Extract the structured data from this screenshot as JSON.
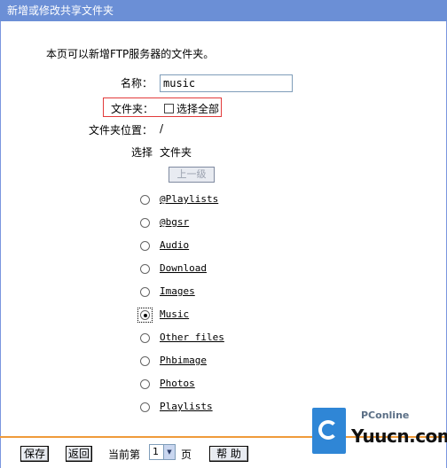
{
  "title": "新增或修改共享文件夹",
  "intro": "本页可以新增FTP服务器的文件夹。",
  "name_label": "名称：",
  "name_value": "music",
  "folder_label": "文件夹：",
  "select_all_label": "选择全部",
  "location_label": "文件夹位置：",
  "location_value": "/",
  "col_select": "选择",
  "col_folder": "文件夹",
  "up_button": "上一级",
  "folders": [
    {
      "label": "@Playlists",
      "selected": false
    },
    {
      "label": "@bgsr",
      "selected": false
    },
    {
      "label": "Audio",
      "selected": false
    },
    {
      "label": "Download",
      "selected": false
    },
    {
      "label": "Images",
      "selected": false
    },
    {
      "label": "Music",
      "selected": true
    },
    {
      "label": "Other files",
      "selected": false
    },
    {
      "label": "Phbimage",
      "selected": false
    },
    {
      "label": "Photos",
      "selected": false
    },
    {
      "label": "Playlists",
      "selected": false
    }
  ],
  "bottom": {
    "save": "保存",
    "back": "返回",
    "current_page_label": "当前第",
    "current_page": "1",
    "page_suffix": "页",
    "help": "帮 助"
  },
  "watermark": {
    "top": "PConline",
    "main": "Yuucn.com"
  },
  "colors": {
    "titlebar": "#6b8fd6",
    "highlight_border": "#e23a3a",
    "bottom_line": "#ef9a3a",
    "logo_blue": "#2f86d6"
  }
}
